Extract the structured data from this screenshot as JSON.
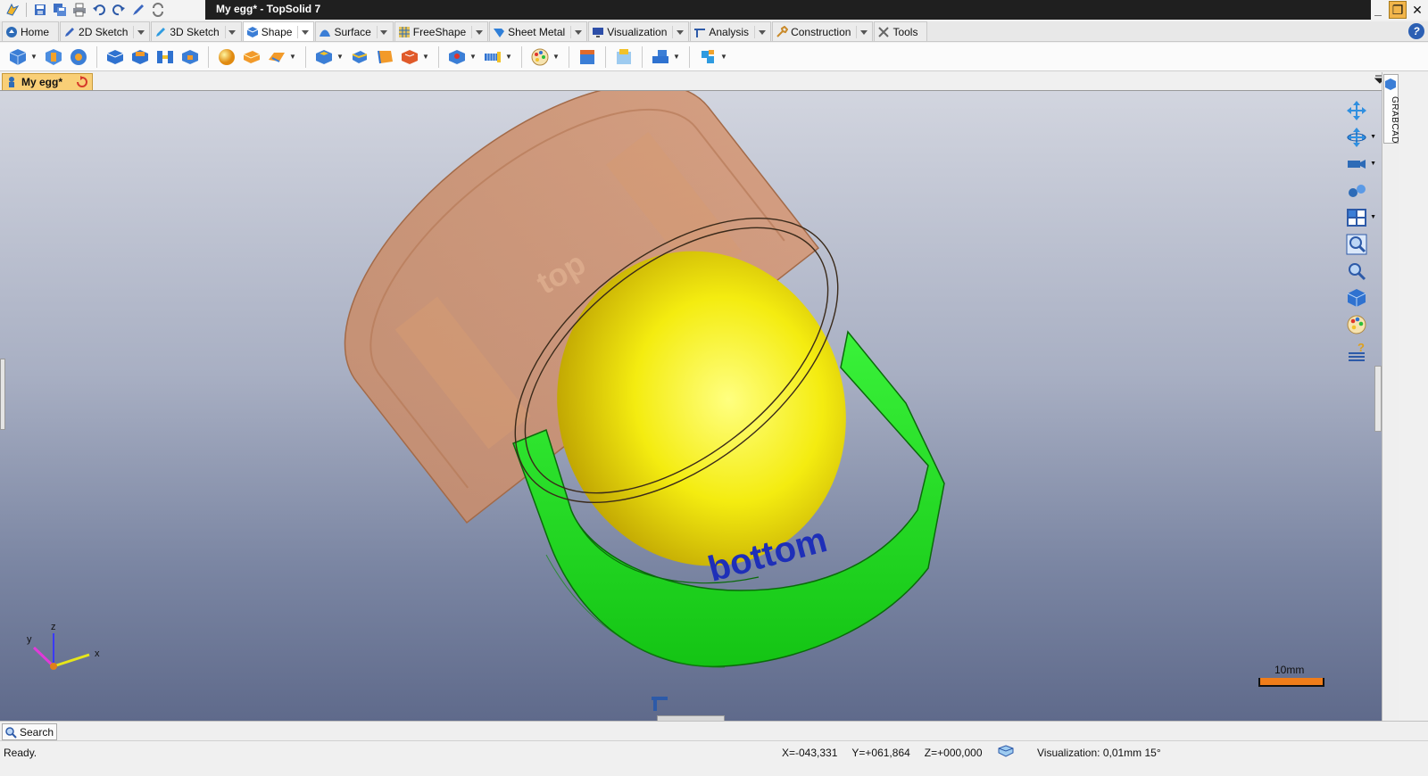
{
  "window": {
    "title": "My egg* - TopSolid 7",
    "controls": {
      "minimize": "_",
      "restore": "❐",
      "close": "✕"
    }
  },
  "quick_access": [
    "app-menu-icon",
    "save-icon",
    "save-all-icon",
    "print-icon",
    "undo-icon",
    "redo-icon",
    "pen-icon",
    "refresh-icon"
  ],
  "tabs": [
    {
      "label": "Home",
      "icon": "home-icon"
    },
    {
      "label": "2D Sketch",
      "icon": "pencil-icon"
    },
    {
      "label": "3D Sketch",
      "icon": "pencil-3d-icon"
    },
    {
      "label": "Shape",
      "icon": "cube-icon"
    },
    {
      "label": "Surface",
      "icon": "surface-icon"
    },
    {
      "label": "FreeShape",
      "icon": "freeshape-icon"
    },
    {
      "label": "Sheet Metal",
      "icon": "sheet-metal-icon"
    },
    {
      "label": "Visualization",
      "icon": "monitor-icon"
    },
    {
      "label": "Analysis",
      "icon": "caliper-icon"
    },
    {
      "label": "Construction",
      "icon": "wrench-icon"
    },
    {
      "label": "Tools",
      "icon": "tools-icon"
    }
  ],
  "active_tab": "Shape",
  "help_label": "?",
  "document": {
    "tab_label": "My egg*"
  },
  "side_panel": {
    "label": "GRABCAD"
  },
  "scale": {
    "label": "10mm"
  },
  "axes": {
    "x": "x",
    "y": "y",
    "z": "z"
  },
  "model": {
    "engraved_text": "bottom",
    "lid_text": "top",
    "colors": {
      "lid": "#d98a57",
      "base": "#1fe01f",
      "egg": "#f2e21a",
      "lettering": "#1e2fb8"
    }
  },
  "search": {
    "label": "Search"
  },
  "status": {
    "text": "Ready.",
    "x": "X=-043,331",
    "y": "Y=+061,864",
    "z": "Z=+000,000",
    "visualization": "Visualization: 0,01mm 15°"
  }
}
